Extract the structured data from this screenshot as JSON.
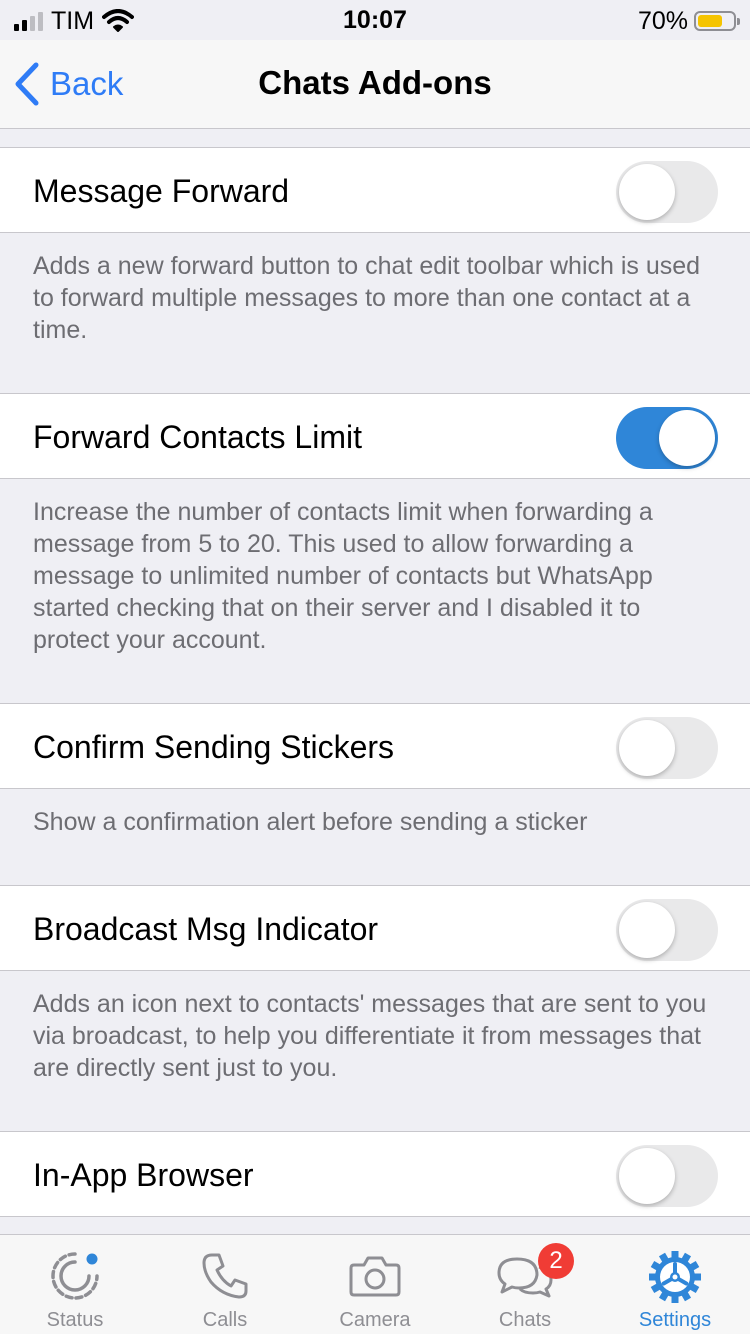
{
  "status_bar": {
    "carrier": "TIM",
    "time": "10:07",
    "battery_percent_label": "70%",
    "battery_level": 0.7,
    "battery_color": "#f5c400"
  },
  "nav": {
    "back_label": "Back",
    "title": "Chats Add-ons",
    "accent_color": "#2f7cf6"
  },
  "settings": [
    {
      "label": "Message Forward",
      "enabled": false,
      "description": "Adds a new forward button to chat edit toolbar which is used to forward multiple messages to more than one contact at a time."
    },
    {
      "label": "Forward Contacts Limit",
      "enabled": true,
      "description": "Increase the number of contacts limit when forwarding a message from 5 to 20. This used to allow forwarding a message to unlimited number of contacts but WhatsApp started checking that on their server and I disabled it to protect your account."
    },
    {
      "label": "Confirm Sending Stickers",
      "enabled": false,
      "description": "Show a confirmation alert before sending a sticker"
    },
    {
      "label": "Broadcast Msg Indicator",
      "enabled": false,
      "description": "Adds an icon next to contacts' messages that are sent to you via broadcast, to help you differentiate it from messages that are directly sent just to you."
    },
    {
      "label": "In-App Browser",
      "enabled": false
    }
  ],
  "tabs": [
    {
      "label": "Status",
      "icon": "status-icon",
      "active": false
    },
    {
      "label": "Calls",
      "icon": "phone-icon",
      "active": false
    },
    {
      "label": "Camera",
      "icon": "camera-icon",
      "active": false
    },
    {
      "label": "Chats",
      "icon": "chat-bubbles-icon",
      "active": false,
      "badge": "2"
    },
    {
      "label": "Settings",
      "icon": "gear-icon",
      "active": true
    }
  ],
  "colors": {
    "toggle_on": "#2f86d8",
    "tab_active": "#2f86d8",
    "badge": "#f03c35"
  }
}
